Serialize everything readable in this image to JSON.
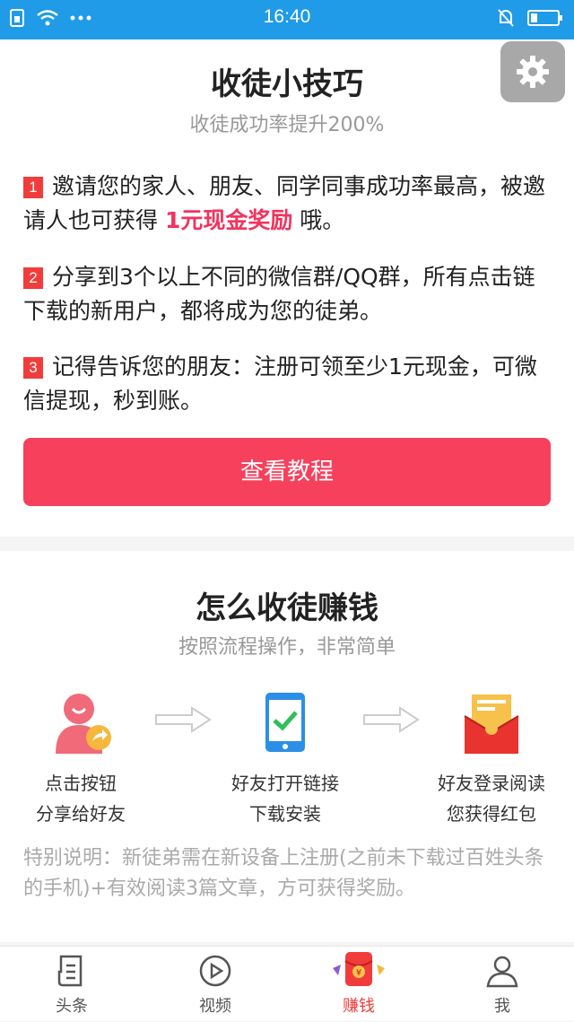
{
  "status_bar": {
    "time": "16:40"
  },
  "tips_card": {
    "title": "收徒小技巧",
    "subtitle": "收徒成功率提升200%",
    "tips": [
      {
        "num": "1",
        "text_before": "邀请您的家人、朋友、同学同事成功率最高，被邀请人也可获得 ",
        "highlight": "1元现金奖励",
        "text_after": " 哦。"
      },
      {
        "num": "2",
        "text": "分享到3个以上不同的微信群/QQ群，所有点击链下载的新用户，都将成为您的徒弟。"
      },
      {
        "num": "3",
        "text": "记得告诉您的朋友：注册可领至少1元现金，可微信提现，秒到账。"
      }
    ],
    "button_label": "查看教程"
  },
  "earn_card": {
    "title": "怎么收徒赚钱",
    "subtitle": "按照流程操作，非常简单",
    "steps": [
      {
        "icon": "share-user-icon",
        "line1": "点击按钮",
        "line2": "分享给好友"
      },
      {
        "icon": "phone-check-icon",
        "line1": "好友打开链接",
        "line2": "下载安装"
      },
      {
        "icon": "red-envelope-icon",
        "line1": "好友登录阅读",
        "line2": "您获得红包"
      }
    ],
    "note": "特别说明：新徒弟需在新设备上注册(之前未下载过百姓头条的手机)+有效阅读3篇文章，方可获得奖励。"
  },
  "tabbar": {
    "tabs": [
      {
        "label": "头条",
        "icon": "news-icon"
      },
      {
        "label": "视频",
        "icon": "video-icon"
      },
      {
        "label": "赚钱",
        "icon": "money-envelope-icon",
        "active": true
      },
      {
        "label": "我",
        "icon": "profile-icon"
      }
    ]
  },
  "colors": {
    "status_bar": "#1f9be8",
    "accent": "#f7405c",
    "highlight": "#f2335d"
  }
}
